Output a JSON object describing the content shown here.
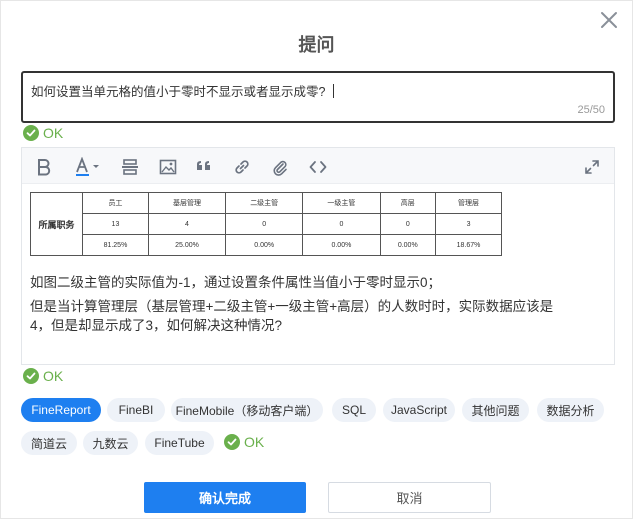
{
  "dialog": {
    "title": "提问",
    "close_icon": "close-icon"
  },
  "question": {
    "value": "如何设置当单元格的值小于零时不显示或者显示成零?",
    "counter": "25/50"
  },
  "ok_label": "OK",
  "toolbar": {
    "icons": [
      "bold-icon",
      "font-color-icon",
      "divider-icon",
      "image-icon",
      "quote-icon",
      "link-icon",
      "attachment-icon",
      "code-icon",
      "fullscreen-icon"
    ]
  },
  "embedded_table": {
    "row_header": "所属职务",
    "columns": [
      "员工",
      "基层管理",
      "二级主管",
      "一级主管",
      "高层",
      "管理层"
    ],
    "counts": [
      "13",
      "4",
      "0",
      "0",
      "0",
      "3"
    ],
    "percents": [
      "81.25%",
      "25.00%",
      "0.00%",
      "0.00%",
      "0.00%",
      "18.67%"
    ]
  },
  "body": {
    "line1": "如图二级主管的实际值为-1，通过设置条件属性当值小于零时显示0；",
    "line2": "但是当计算管理层（基层管理+二级主管+一级主管+高层）的人数时时，实际数据应该是",
    "line3": "4，但是却显示成了3，如何解决这种情况?"
  },
  "tags": [
    {
      "label": "FineReport",
      "active": true
    },
    {
      "label": "FineBI",
      "active": false
    },
    {
      "label": "FineMobile（移动客户端）",
      "active": false
    },
    {
      "label": "SQL",
      "active": false
    },
    {
      "label": "JavaScript",
      "active": false
    },
    {
      "label": "其他问题",
      "active": false
    },
    {
      "label": "数据分析",
      "active": false
    },
    {
      "label": "简道云",
      "active": false
    },
    {
      "label": "九数云",
      "active": false
    },
    {
      "label": "FineTube",
      "active": false
    }
  ],
  "buttons": {
    "confirm": "确认完成",
    "cancel": "取消"
  },
  "colors": {
    "accent": "#1e7ff0",
    "ok_green": "#6ab04c",
    "tag_bg": "#eef2f8"
  }
}
